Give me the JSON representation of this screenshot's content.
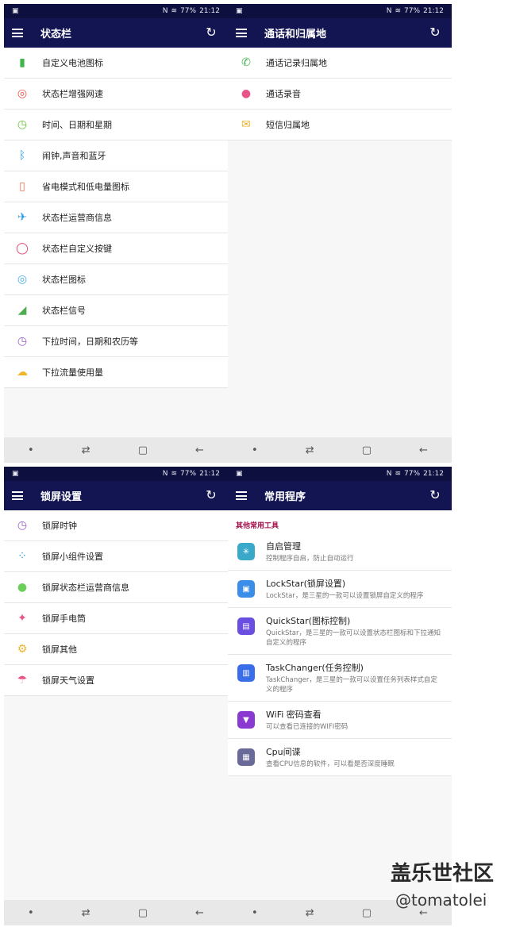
{
  "status": {
    "time": "21:12",
    "battery": "77%"
  },
  "panel1": {
    "title": "状态栏",
    "items": [
      {
        "label": "自定义电池图标",
        "icon": "battery-icon",
        "color": "#3fb54b"
      },
      {
        "label": "状态栏增强网速",
        "icon": "speed-icon",
        "color": "#e8544a"
      },
      {
        "label": "时间、日期和星期",
        "icon": "clock-icon",
        "color": "#6bbf3a"
      },
      {
        "label": "闹钟,声音和蓝牙",
        "icon": "bluetooth-icon",
        "color": "#2d9be8"
      },
      {
        "label": "省电模式和低电量图标",
        "icon": "low-battery-icon",
        "color": "#f0704a"
      },
      {
        "label": "状态栏运营商信息",
        "icon": "carrier-icon",
        "color": "#2d9be8"
      },
      {
        "label": "状态栏自定义按键",
        "icon": "ring-icon",
        "color": "#e8436a"
      },
      {
        "label": "状态栏图标",
        "icon": "target-icon",
        "color": "#4aaee8"
      },
      {
        "label": "状态栏信号",
        "icon": "signal-icon",
        "color": "#4cae4f"
      },
      {
        "label": "下拉时间，日期和农历等",
        "icon": "clock-icon",
        "color": "#9d5cc7"
      },
      {
        "label": "下拉流量使用量",
        "icon": "cloud-icon",
        "color": "#f0b429"
      }
    ]
  },
  "panel2": {
    "title": "通话和归属地",
    "items": [
      {
        "label": "通话记录归属地",
        "icon": "phone-icon",
        "color": "#3fb54b"
      },
      {
        "label": "通话录音",
        "icon": "record-icon",
        "color": "#e8548a"
      },
      {
        "label": "短信归属地",
        "icon": "mail-icon",
        "color": "#f0b429"
      }
    ]
  },
  "panel3": {
    "title": "锁屏设置",
    "items": [
      {
        "label": "锁屏时钟",
        "icon": "clock-icon",
        "color": "#9d5cc7"
      },
      {
        "label": "锁屏小组件设置",
        "icon": "widgets-icon",
        "color": "#2d9be8"
      },
      {
        "label": "锁屏状态栏运营商信息",
        "icon": "dot-icon",
        "color": "#6bcf5a"
      },
      {
        "label": "锁屏手电筒",
        "icon": "bulb-icon",
        "color": "#e8548a"
      },
      {
        "label": "锁屏其他",
        "icon": "gear-icon",
        "color": "#f0b429"
      },
      {
        "label": "锁屏天气设置",
        "icon": "weather-icon",
        "color": "#e8548a"
      }
    ]
  },
  "panel4": {
    "title": "常用程序",
    "section": "其他常用工具",
    "items": [
      {
        "name": "自启管理",
        "desc": "控制程序自启，防止自动运行",
        "icon": "spinner-icon",
        "color": "#3aa9c9"
      },
      {
        "name": "LockStar(锁屏设置)",
        "desc": "LockStar，是三星的一款可以设置锁屏自定义的程序",
        "icon": "lockstar-icon",
        "color": "#3a8ee8"
      },
      {
        "name": "QuickStar(图标控制)",
        "desc": "QuickStar，是三星的一款可以设置状态栏图标和下拉通知自定义的程序",
        "icon": "quickstar-icon",
        "color": "#6a4ee0"
      },
      {
        "name": "TaskChanger(任务控制)",
        "desc": "TaskChanger，是三星的一款可以设置任务列表样式自定义的程序",
        "icon": "taskchanger-icon",
        "color": "#3a6ee8"
      },
      {
        "name": "WiFi 密码查看",
        "desc": "可以查看已连接的WIFI密码",
        "icon": "wifi-icon",
        "color": "#8a3ad0"
      },
      {
        "name": "Cpu间谍",
        "desc": "查看CPU信息的软件，可以看是否深度睡眠",
        "icon": "cpu-icon",
        "color": "#6a6a9a"
      }
    ]
  },
  "watermark": {
    "line1": "盖乐世社区",
    "line2": "@tomatolei"
  }
}
